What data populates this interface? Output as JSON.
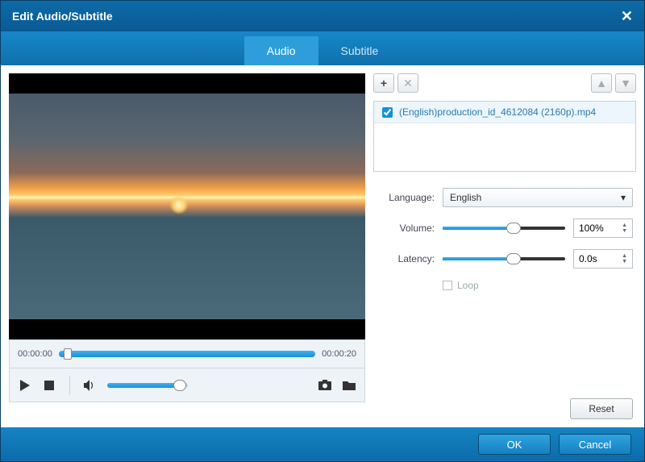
{
  "title": "Edit Audio/Subtitle",
  "tabs": {
    "audio": "Audio",
    "subtitle": "Subtitle"
  },
  "timeline": {
    "current": "00:00:00",
    "total": "00:00:20"
  },
  "tracks": [
    {
      "checked": true,
      "label": "(English)production_id_4612084 (2160p).mp4"
    }
  ],
  "settings": {
    "language_label": "Language:",
    "language_value": "English",
    "volume_label": "Volume:",
    "volume_value": "100%",
    "latency_label": "Latency:",
    "latency_value": "0.0s",
    "loop_label": "Loop"
  },
  "buttons": {
    "reset": "Reset",
    "ok": "OK",
    "cancel": "Cancel"
  }
}
